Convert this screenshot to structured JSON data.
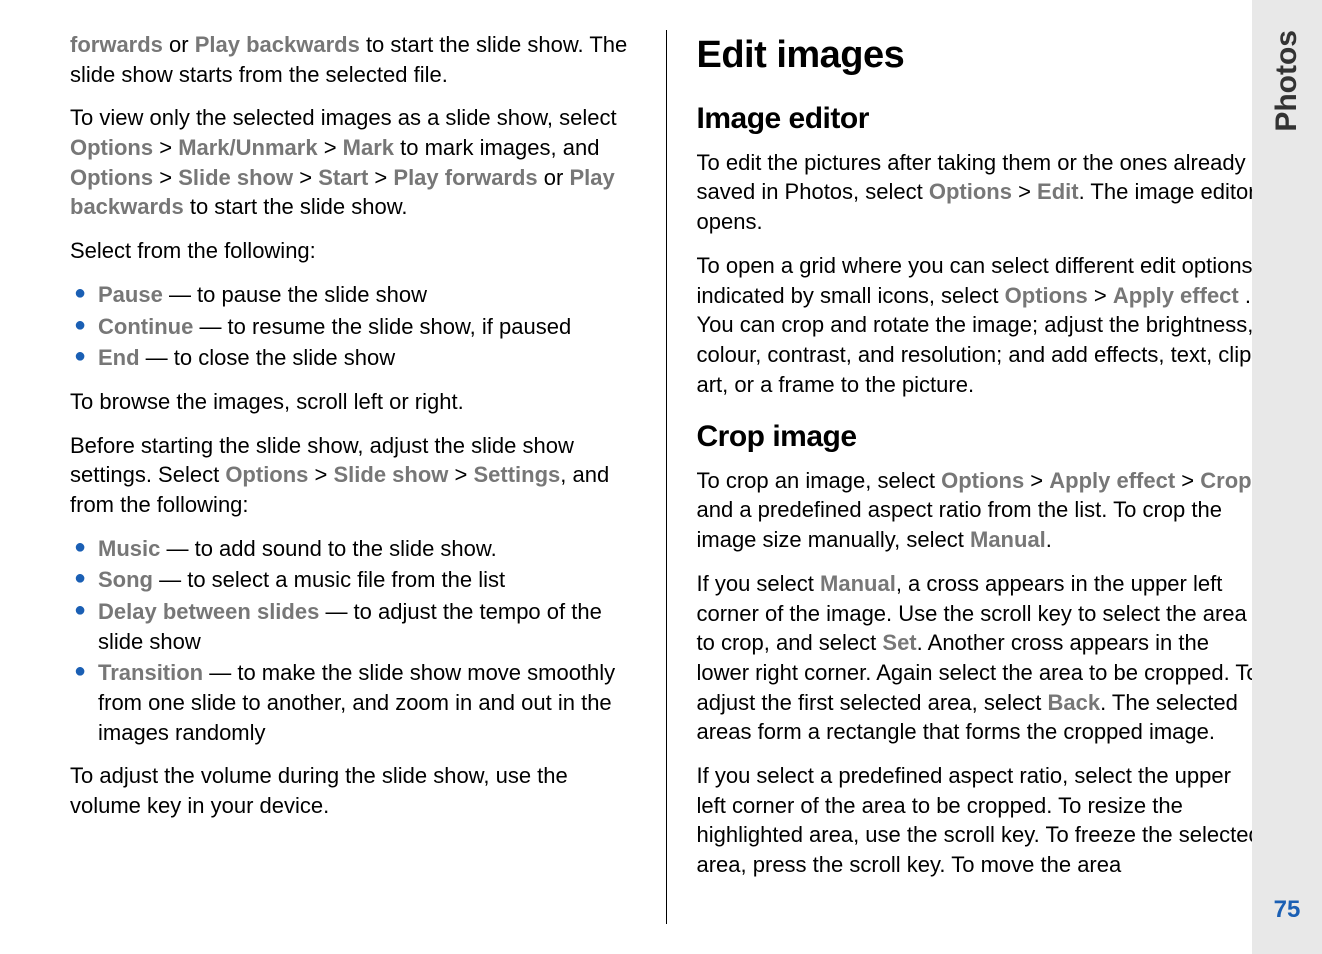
{
  "sidebar": {
    "section": "Photos",
    "page_number": "75"
  },
  "left": {
    "p1": {
      "parts": [
        {
          "t": "forwards",
          "o": true
        },
        {
          "t": " or "
        },
        {
          "t": "Play backwards",
          "o": true
        },
        {
          "t": " to start the slide show. The slide show starts from the selected file."
        }
      ]
    },
    "p2": {
      "parts": [
        {
          "t": "To view only the selected images as a slide show, select "
        },
        {
          "t": "Options",
          "o": true
        },
        {
          "t": " > "
        },
        {
          "t": "Mark/Unmark",
          "o": true
        },
        {
          "t": " > "
        },
        {
          "t": "Mark",
          "o": true
        },
        {
          "t": " to mark images, and "
        },
        {
          "t": "Options",
          "o": true
        },
        {
          "t": " > "
        },
        {
          "t": "Slide show",
          "o": true
        },
        {
          "t": " > "
        },
        {
          "t": "Start",
          "o": true
        },
        {
          "t": " > "
        },
        {
          "t": "Play forwards",
          "o": true
        },
        {
          "t": " or "
        },
        {
          "t": "Play backwards",
          "o": true
        },
        {
          "t": " to start the slide show."
        }
      ]
    },
    "p3": {
      "parts": [
        {
          "t": "Select from the following:"
        }
      ]
    },
    "list1": [
      {
        "parts": [
          {
            "t": "Pause",
            "o": true
          },
          {
            "t": "  — to pause the slide show"
          }
        ]
      },
      {
        "parts": [
          {
            "t": "Continue",
            "o": true
          },
          {
            "t": "  — to resume the slide show, if paused"
          }
        ]
      },
      {
        "parts": [
          {
            "t": "End",
            "o": true
          },
          {
            "t": "  — to close the slide show"
          }
        ]
      }
    ],
    "p4": {
      "parts": [
        {
          "t": "To browse the images, scroll left or right."
        }
      ]
    },
    "p5": {
      "parts": [
        {
          "t": "Before starting the slide show, adjust the slide show settings. Select "
        },
        {
          "t": "Options",
          "o": true
        },
        {
          "t": " > "
        },
        {
          "t": "Slide show",
          "o": true
        },
        {
          "t": " > "
        },
        {
          "t": "Settings",
          "o": true
        },
        {
          "t": ", and from the following:"
        }
      ]
    },
    "list2": [
      {
        "parts": [
          {
            "t": "Music",
            "o": true
          },
          {
            "t": "  — to add sound to the slide show."
          }
        ]
      },
      {
        "parts": [
          {
            "t": "Song",
            "o": true
          },
          {
            "t": "  — to select a music file from the list"
          }
        ]
      },
      {
        "parts": [
          {
            "t": "Delay between slides",
            "o": true
          },
          {
            "t": "  — to adjust the tempo of the slide show"
          }
        ]
      },
      {
        "parts": [
          {
            "t": "Transition",
            "o": true
          },
          {
            "t": "  — to make the slide show move smoothly from one slide to another, and zoom in and out in the images randomly"
          }
        ]
      }
    ],
    "p6": {
      "parts": [
        {
          "t": "To adjust the volume during the slide show, use the volume key in your device."
        }
      ]
    }
  },
  "right": {
    "h1": "Edit images",
    "h2a": "Image editor",
    "p1": {
      "parts": [
        {
          "t": "To edit the pictures after taking them or the ones already saved in Photos, select "
        },
        {
          "t": "Options",
          "o": true
        },
        {
          "t": " > "
        },
        {
          "t": "Edit",
          "o": true
        },
        {
          "t": ". The image editor opens."
        }
      ]
    },
    "p2": {
      "parts": [
        {
          "t": "To open a grid where you can select different edit options indicated by small icons, select "
        },
        {
          "t": "Options",
          "o": true
        },
        {
          "t": " > "
        },
        {
          "t": "Apply effect",
          "o": true
        },
        {
          "t": " . You can crop and rotate the image; adjust the brightness, colour, contrast, and resolution; and add effects, text, clip art, or a frame to the picture."
        }
      ]
    },
    "h2b": "Crop image",
    "p3": {
      "parts": [
        {
          "t": "To crop an image, select "
        },
        {
          "t": "Options",
          "o": true
        },
        {
          "t": " > "
        },
        {
          "t": "Apply effect",
          "o": true
        },
        {
          "t": " > "
        },
        {
          "t": "Crop",
          "o": true
        },
        {
          "t": ", and a predefined aspect ratio from the list. To crop the image size manually, select "
        },
        {
          "t": "Manual",
          "o": true
        },
        {
          "t": "."
        }
      ]
    },
    "p4": {
      "parts": [
        {
          "t": "If you select "
        },
        {
          "t": "Manual",
          "o": true
        },
        {
          "t": ", a cross appears in the upper left corner of the image. Use the scroll key to select the area to crop, and select "
        },
        {
          "t": "Set",
          "o": true
        },
        {
          "t": ". Another cross appears in the lower right corner. Again select the area to be cropped. To adjust the first selected area, select "
        },
        {
          "t": "Back",
          "o": true
        },
        {
          "t": ". The selected areas form a rectangle that forms the cropped image."
        }
      ]
    },
    "p5": {
      "parts": [
        {
          "t": "If you select a predefined aspect ratio, select the upper left corner of the area to be cropped. To resize the highlighted area, use the scroll key. To freeze the selected area, press the scroll key. To move the area"
        }
      ]
    }
  }
}
